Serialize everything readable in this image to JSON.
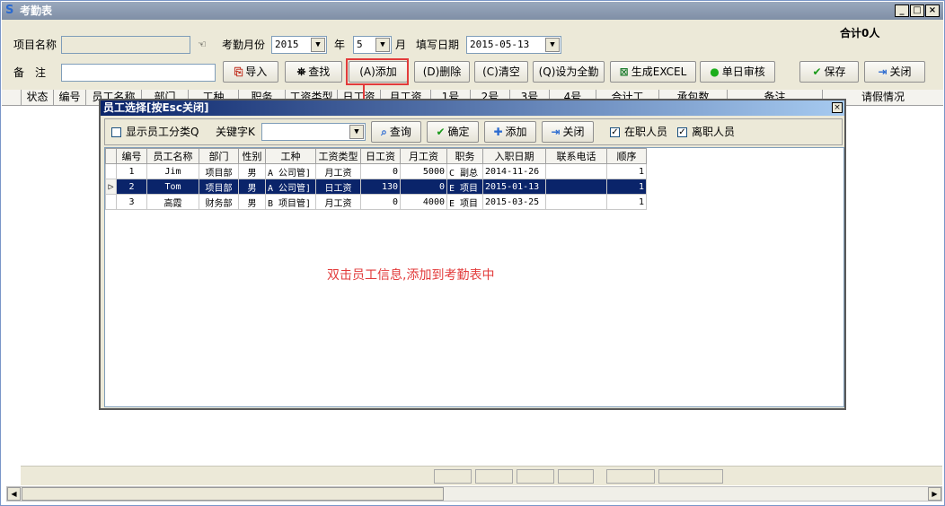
{
  "window": {
    "title": "考勤表",
    "controls": [
      "_",
      "□",
      "×"
    ]
  },
  "header": {
    "project_label": "项目名称",
    "project_value": "",
    "month_label": "考勤月份",
    "year_value": "2015",
    "year_unit": "年",
    "month_value": "5",
    "month_unit": "月",
    "fill_date_label": "填写日期",
    "fill_date_value": "2015-05-13",
    "total_label": "合计0人",
    "remark_label": "备　注",
    "remark_value": ""
  },
  "toolbar": {
    "import": "导入",
    "find": "查找",
    "add": "(A)添加",
    "delete": "(D)删除",
    "clear": "(C)清空",
    "set_full": "(Q)设为全勤",
    "excel": "生成EXCEL",
    "day_audit": "单日审核",
    "save": "保存",
    "close": "关闭"
  },
  "main_grid": {
    "columns": [
      "状态",
      "编号",
      "员工名称",
      "部门",
      "工种",
      "职务",
      "工资类型",
      "日工资",
      "月工资",
      "1号",
      "2号",
      "3号",
      "4号",
      "合计工",
      "承包数",
      "备注",
      "请假情况"
    ]
  },
  "dialog": {
    "title": "员工选择[按Esc关闭]",
    "show_category_label": "显示员工分类Q",
    "show_category_checked": false,
    "keyword_label": "关键字K",
    "keyword_value": "",
    "query_btn": "查询",
    "ok_btn": "确定",
    "add_btn": "添加",
    "close_btn": "关闭",
    "active_label": "在职人员",
    "active_checked": true,
    "left_label": "离职人员",
    "left_checked": true,
    "columns": [
      "编号",
      "员工名称",
      "部门",
      "性别",
      "工种",
      "工资类型",
      "日工资",
      "月工资",
      "职务",
      "入职日期",
      "联系电话",
      "顺序"
    ],
    "rows": [
      {
        "id": "1",
        "name": "Jim",
        "dept": "项目部",
        "sex": "男",
        "job": "A 公司管]",
        "wage_type": "月工资",
        "daily": "0",
        "monthly": "5000",
        "post": "C 副总",
        "date": "2014-11-26",
        "phone": "",
        "order": "1"
      },
      {
        "id": "2",
        "name": "Tom",
        "dept": "项目部",
        "sex": "男",
        "job": "A 公司管]",
        "wage_type": "日工资",
        "daily": "130",
        "monthly": "0",
        "post": "E 项目",
        "date": "2015-01-13",
        "phone": "",
        "order": "1"
      },
      {
        "id": "3",
        "name": "高霞",
        "dept": "财务部",
        "sex": "男",
        "job": "B 项目管]",
        "wage_type": "月工资",
        "daily": "0",
        "monthly": "4000",
        "post": "E 项目",
        "date": "2015-03-25",
        "phone": "",
        "order": "1"
      }
    ],
    "selected_row": 1
  },
  "annotation": {
    "hint": "双击员工信息,添加到考勤表中",
    "color": "#e23b3b"
  }
}
